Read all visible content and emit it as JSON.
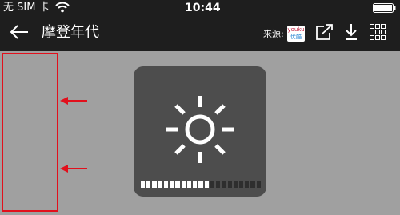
{
  "status_bar": {
    "carrier": "无 SIM 卡",
    "time": "10:44",
    "battery_icon": "battery-icon",
    "wifi_icon": "wifi-icon"
  },
  "nav_bar": {
    "title": "摩登年代",
    "source_label": "来源:",
    "source_logo_top": "youku",
    "source_logo_bottom": "优酷",
    "back_icon": "back-arrow-icon",
    "share_icon": "share-icon",
    "download_icon": "download-icon",
    "grid_icon": "grid-icon"
  },
  "brightness_hud": {
    "icon": "sun-icon",
    "level": 0.57,
    "segments_total": 21,
    "segments_filled": 12
  },
  "colors": {
    "bar_bg": "#1e1e1e",
    "content_bg": "#a0a0a0",
    "hud_bg": "#4d4d4d",
    "highlight": "#e2101c",
    "segment_on": "#ffffff",
    "segment_off": "#2e2e2e"
  }
}
